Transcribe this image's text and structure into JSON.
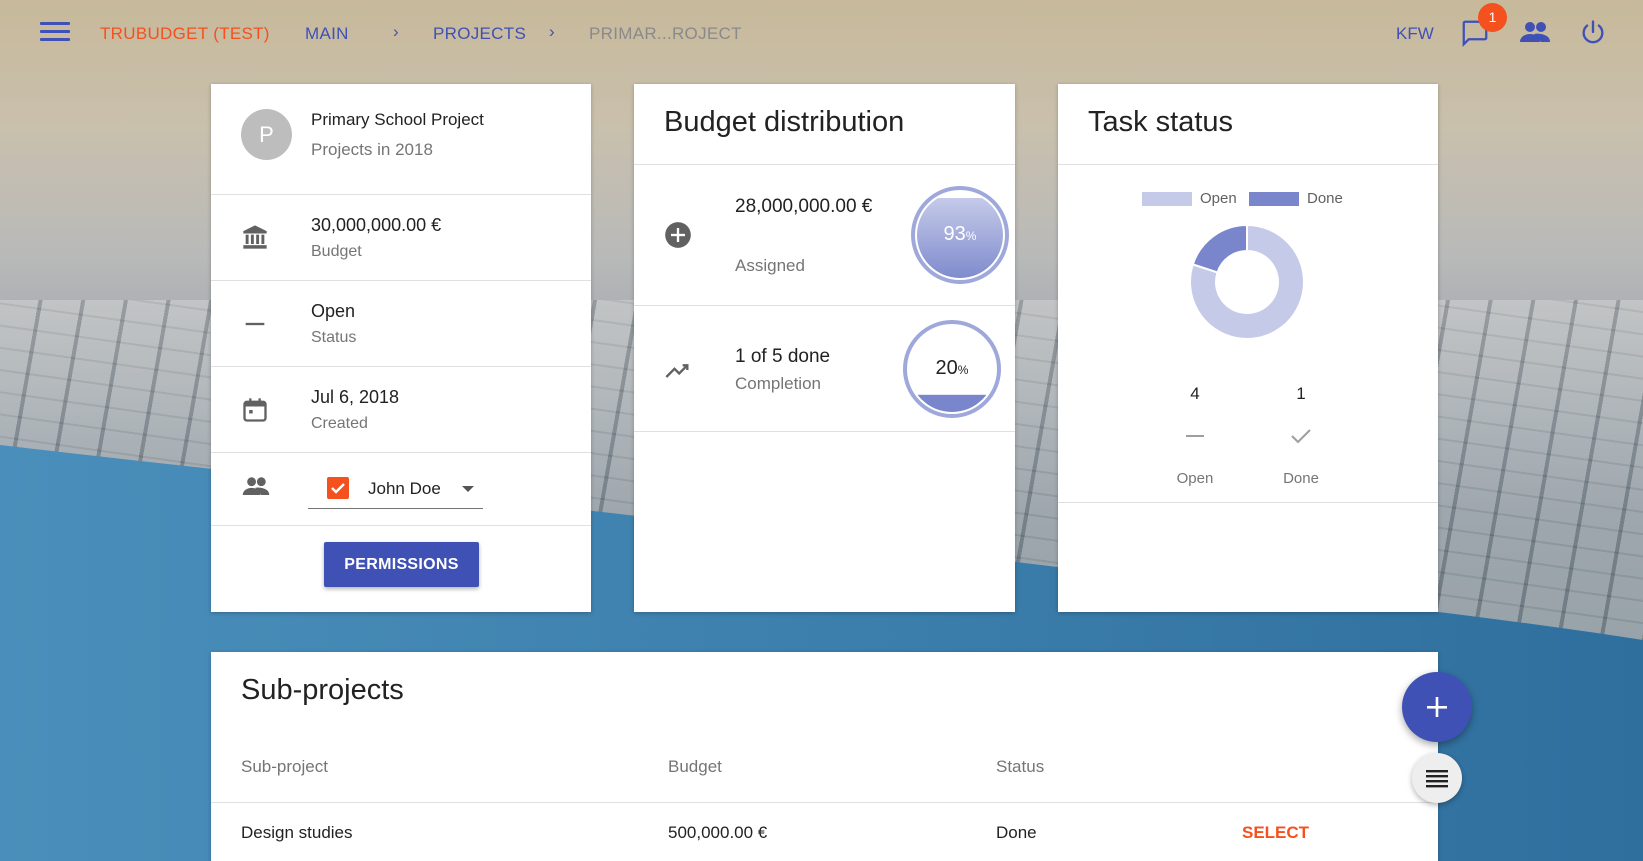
{
  "header": {
    "app_title": "TRUBUDGET (TEST)",
    "breadcrumbs": [
      "MAIN",
      "PROJECTS",
      "PRIMAR...ROJECT"
    ],
    "separator": "›",
    "organization": "KFW",
    "notification_count": "1"
  },
  "project": {
    "avatar_letter": "P",
    "name": "Primary School Project",
    "subtitle": "Projects in 2018",
    "budget_value": "30,000,000.00 €",
    "budget_label": "Budget",
    "status_value": "Open",
    "status_label": "Status",
    "created_value": "Jul 6, 2018",
    "created_label": "Created",
    "assignee": "John Doe",
    "permissions_label": "PERMISSIONS"
  },
  "budget_distribution": {
    "title": "Budget distribution",
    "assigned_value": "28,000,000.00 €",
    "assigned_label": "Assigned",
    "assigned_percent": "93",
    "completion_value": "1 of 5 done",
    "completion_label": "Completion",
    "completion_percent": "20",
    "percent_sign": "%"
  },
  "task_status": {
    "title": "Task status",
    "legend": [
      "Open",
      "Done"
    ],
    "open_count": "4",
    "done_count": "1",
    "open_label": "Open",
    "done_label": "Done",
    "colors": {
      "open": "#c5cae9",
      "done": "#7986cb"
    }
  },
  "sub_projects": {
    "title": "Sub-projects",
    "columns": [
      "Sub-project",
      "Budget",
      "Status"
    ],
    "rows": [
      {
        "name": "Design studies",
        "budget": "500,000.00 €",
        "status": "Done",
        "action": "SELECT"
      }
    ]
  },
  "colors": {
    "primary": "#3f51b5",
    "accent": "#f4511e",
    "wave": "#3a82b0"
  },
  "icons": {
    "menu": "menu-icon",
    "notifications": "chat-icon",
    "users": "people-icon",
    "logout": "power-icon",
    "budget": "bank-icon",
    "status": "dash-icon",
    "created": "calendar-icon",
    "assignee": "people-icon",
    "assigned": "add-circle-icon",
    "completion": "trending-up-icon",
    "add": "plus-icon",
    "list": "list-icon"
  }
}
